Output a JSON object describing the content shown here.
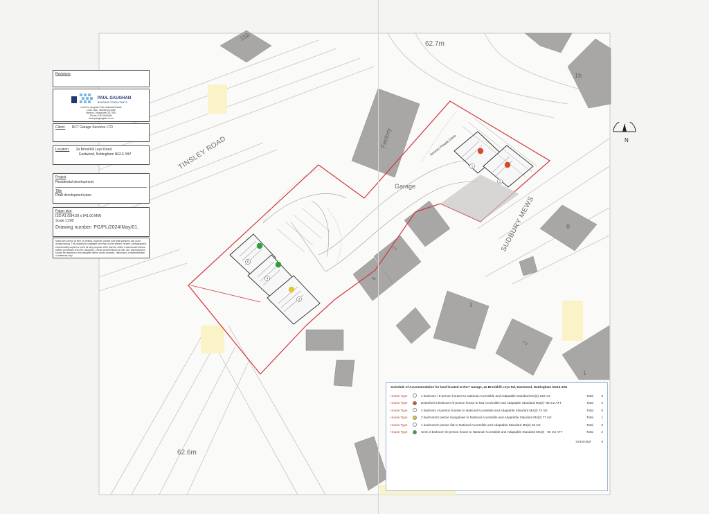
{
  "map": {
    "street_labels": {
      "tinsley_road": "TINSLEY ROAD",
      "sudbury_mews": "SUDBURY MEWS",
      "factory": "Factory",
      "garage": "Garage",
      "access_drive": "Access Private Drive"
    },
    "levels": {
      "top": "62.7m",
      "bottom": "62.6m"
    },
    "house_numbers": [
      "15b",
      "1b",
      "8",
      "2",
      "4",
      "3",
      "2",
      "1"
    ],
    "plot_numbers": [
      "1",
      "2",
      "3",
      "4",
      "5"
    ],
    "north": "N",
    "colors": {
      "site_boundary": "#d0343c",
      "building_grey": "#a9a6a6",
      "dot_red": "#d8482a",
      "dot_green": "#2f9e3a",
      "dot_yellow": "#e3c62a",
      "highlight_yellow": "#fbf3c8"
    }
  },
  "title_block": {
    "revisions_label": "Revisions",
    "company_name": "PAUL GAUGHAN",
    "company_sub": "BUILDING CONSULTANTS",
    "address_lines": [
      "Unit 9 In Langham Park Industrial Estate",
      "Lows Lane, Stanton-by-Dale",
      "Ilkeston, Derbyshire DE7 4RJ",
      "Phone: 0115 9444464",
      "www.paulgaughan.co.uk"
    ],
    "client_label": "Client:",
    "client_value": "RCT Garage Services LTD",
    "location_label": "Location:",
    "location_line1": "2a Brookhill Leys Road,",
    "location_line2": "Eastwood, Nottingham NG16 3HZ",
    "project_label": "Project",
    "project_value": "Residential development.",
    "title_label": "Title",
    "title_value": "Draft development plan.",
    "paper_label": "Paper size",
    "paper_value": "ISO A1 (594.00 x 841.00 MM)",
    "scale_value": "Scale 1:200",
    "drawing_number": "Drawing number: PG/PL/2024/May/01.",
    "notes": "Notes are correct at time of printing, however, please note that sketches can occur during issuing. This drawing is copyright and may not be altered, reused, photographed, electronically copied or used for any purpose other than for which it was issued without written permission from Mr. Gaughan. Check all dimensions on site. Any discrepancies should be reported to the designer before works proceed. Hatching is a representation of materials only."
  },
  "schedule": {
    "title": "Schedule of Accommodation for land located at RCT Garage, 2a Brookhill Leys Rd, Eastwood, Nottingham NG16 3HZ",
    "rows": [
      {
        "type": "House Type",
        "dot": "#ffffff",
        "desc": "4 bedroom / 8-person houses to National Accessible and Adaptable Standard M4(2) 130 m2",
        "total_label": "Total",
        "total": "0"
      },
      {
        "type": "House Type",
        "dot": "#d8482a",
        "desc": "Detached 3 bedroom /5-person house to Nat Accessible and Adaptable Standard M4(2)- 85 m2 ATT",
        "total_label": "Total",
        "total": "2"
      },
      {
        "type": "House Type",
        "dot": "#ffffff",
        "desc": "2 bedroom /4 person houses to National Accessible and Adaptable Standard M4(2) 73 m2",
        "total_label": "Total",
        "total": "0"
      },
      {
        "type": "House Type",
        "dot": "#e3c62a",
        "desc": "2 bedroom/3 person bungalows to National Accessible and Adaptable Standard M4(2) 77 m2",
        "total_label": "Total",
        "total": "1"
      },
      {
        "type": "House Type",
        "dot": "#ffffff",
        "desc": "1 bedroom/2 person flat to National Accessible and Adaptable Standard M4(2) 48 m2",
        "total_label": "Total",
        "total": "0"
      },
      {
        "type": "House Type",
        "dot": "#2f9e3a",
        "desc": "Semi 3 bedroom /5-person house to National Accessible and Adaptable Standard M4(2) - 90 m2 ATT",
        "total_label": "Total",
        "total": "2"
      }
    ],
    "grand_total_label": "Grant total",
    "grand_total": "5"
  }
}
